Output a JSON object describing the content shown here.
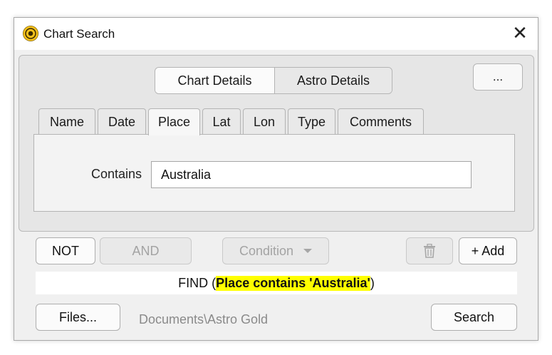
{
  "window": {
    "title": "Chart Search",
    "app_icon": "astro-gold-icon",
    "close_glyph": "✕"
  },
  "segmented": {
    "items": [
      {
        "label": "Chart Details",
        "selected": true
      },
      {
        "label": "Astro Details",
        "selected": false
      }
    ]
  },
  "more_button": {
    "label": "..."
  },
  "tabs": [
    {
      "label": "Name",
      "selected": false
    },
    {
      "label": "Date",
      "selected": false
    },
    {
      "label": "Place",
      "selected": true
    },
    {
      "label": "Lat",
      "selected": false
    },
    {
      "label": "Lon",
      "selected": false
    },
    {
      "label": "Type",
      "selected": false
    },
    {
      "label": "Comments",
      "selected": false
    }
  ],
  "criteria": {
    "label": "Contains",
    "value": "Australia"
  },
  "logic_buttons": {
    "not_label": "NOT",
    "and_label": "AND",
    "condition_label": "Condition",
    "add_label": "+ Add",
    "delete_icon": "trash-icon"
  },
  "find": {
    "prefix": "FIND (",
    "highlight": "Place contains 'Australia'",
    "suffix": ")",
    "highlight_color": "#ffff00"
  },
  "footer": {
    "files_label": "Files...",
    "path": "Documents\\Astro Gold",
    "search_label": "Search"
  }
}
